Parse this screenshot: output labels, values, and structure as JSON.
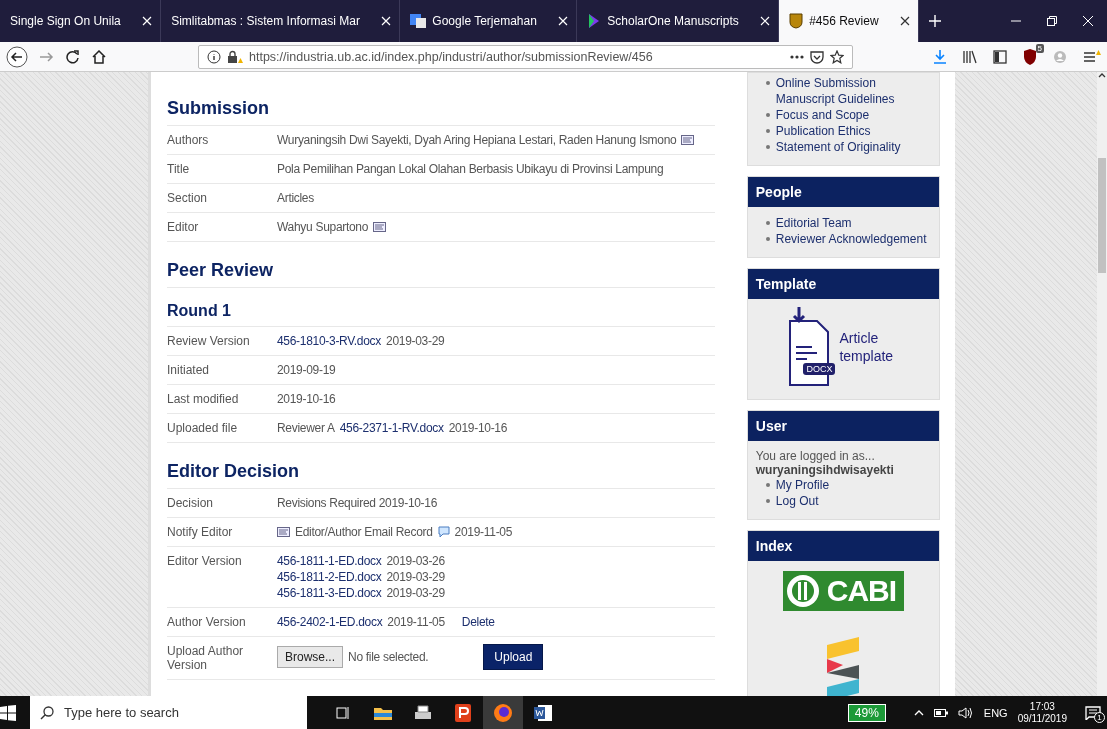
{
  "browser": {
    "tabs": [
      {
        "title": "Single Sign On Unila",
        "selected": false
      },
      {
        "title": "Simlitabmas : Sistem Informasi Mar",
        "selected": false
      },
      {
        "title": "Google Terjemahan",
        "selected": false
      },
      {
        "title": "ScholarOne Manuscripts",
        "selected": false
      },
      {
        "title": "#456 Review",
        "selected": true
      }
    ],
    "url": "https://industria.ub.ac.id/index.php/industri/author/submissionReview/456",
    "extension_count": "5"
  },
  "sections": [
    {
      "heading": "Submission",
      "kind": "section",
      "rows": [
        {
          "label": "Authors",
          "lines": [
            [
              {
                "kind": "text",
                "text": "Wuryaningsih Dwi Sayekti, Dyah Aring Hepiana Lestari, Raden Hanung Ismono"
              },
              {
                "kind": "email_icon"
              }
            ]
          ]
        },
        {
          "label": "Title",
          "lines": [
            [
              {
                "kind": "text",
                "text": "Pola Pemilihan Pangan Lokal Olahan Berbasis Ubikayu di Provinsi Lampung"
              }
            ]
          ]
        },
        {
          "label": "Section",
          "lines": [
            [
              {
                "kind": "text",
                "text": "Articles"
              }
            ]
          ]
        },
        {
          "label": "Editor",
          "lines": [
            [
              {
                "kind": "text",
                "text": "Wahyu Supartono"
              },
              {
                "kind": "email_icon"
              }
            ]
          ]
        }
      ]
    },
    {
      "heading": "Peer Review",
      "kind": "section"
    },
    {
      "heading": "Round 1",
      "kind": "subsection",
      "rows": [
        {
          "label": "Review Version",
          "lines": [
            [
              {
                "kind": "link",
                "text": "456-1810-3-RV.docx"
              },
              {
                "kind": "text",
                "text": "2019-03-29"
              }
            ]
          ]
        },
        {
          "label": "Initiated",
          "lines": [
            [
              {
                "kind": "text",
                "text": "2019-09-19"
              }
            ]
          ]
        },
        {
          "label": "Last modified",
          "lines": [
            [
              {
                "kind": "text",
                "text": "2019-10-16"
              }
            ]
          ]
        },
        {
          "label": "Uploaded file",
          "lines": [
            [
              {
                "kind": "text",
                "text": "Reviewer A"
              },
              {
                "kind": "link",
                "text": "456-2371-1-RV.docx"
              },
              {
                "kind": "text",
                "text": "2019-10-16"
              }
            ]
          ]
        }
      ]
    },
    {
      "heading": "Editor Decision",
      "kind": "section",
      "rows": [
        {
          "label": "Decision",
          "lines": [
            [
              {
                "kind": "text",
                "text": "Revisions Required 2019-10-16"
              }
            ]
          ]
        },
        {
          "label": "Notify Editor",
          "lines": [
            [
              {
                "kind": "email_icon"
              },
              {
                "kind": "text",
                "text": "Editor/Author Email Record"
              },
              {
                "kind": "comment_icon"
              },
              {
                "kind": "text",
                "text": "2019-11-05"
              }
            ]
          ]
        },
        {
          "label": "Editor Version",
          "lines": [
            [
              {
                "kind": "link",
                "text": "456-1811-1-ED.docx"
              },
              {
                "kind": "text",
                "text": "2019-03-26"
              }
            ],
            [
              {
                "kind": "link",
                "text": "456-1811-2-ED.docx"
              },
              {
                "kind": "text",
                "text": "2019-03-29"
              }
            ],
            [
              {
                "kind": "link",
                "text": "456-1811-3-ED.docx"
              },
              {
                "kind": "text",
                "text": "2019-03-29"
              }
            ]
          ]
        },
        {
          "label": "Author Version",
          "lines": [
            [
              {
                "kind": "link",
                "text": "456-2402-1-ED.docx"
              },
              {
                "kind": "text",
                "text": "2019-11-05"
              },
              {
                "kind": "action_link",
                "text": "Delete"
              }
            ]
          ]
        },
        {
          "label": "Upload Author Version",
          "lines": [
            [
              {
                "kind": "browse_button",
                "text": "Browse..."
              },
              {
                "kind": "text",
                "text": "No file selected."
              },
              {
                "kind": "submit_button",
                "text": "Upload"
              }
            ]
          ]
        }
      ]
    }
  ],
  "sidebar": [
    {
      "kind": "links",
      "items": [
        "Online Submission Manuscript Guidelines",
        "Focus and Scope",
        "Publication Ethics",
        "Statement of Originality"
      ]
    },
    {
      "kind": "links",
      "title": "People",
      "items": [
        "Editorial Team",
        "Reviewer Acknowledgement"
      ]
    },
    {
      "kind": "template",
      "title": "Template",
      "label": "Article template",
      "file_type": "DOCX"
    },
    {
      "kind": "user",
      "title": "User",
      "intro": "You are logged in as...",
      "username": "wuryaningsihdwisayekti",
      "items": [
        "My Profile",
        "Log Out"
      ]
    },
    {
      "kind": "index",
      "title": "Index",
      "logo_text": "CABI"
    }
  ],
  "taskbar": {
    "search_placeholder": "Type here to search",
    "apps": [
      {
        "kind": "task_view",
        "active": false
      },
      {
        "kind": "explorer",
        "active": false
      },
      {
        "kind": "printer",
        "active": false
      },
      {
        "kind": "reader",
        "active": false
      },
      {
        "kind": "firefox",
        "active": true
      },
      {
        "kind": "word",
        "active": false
      }
    ],
    "battery": "49%",
    "language": "ENG",
    "time": "17:03",
    "date": "09/11/2019",
    "notifications": "1"
  }
}
